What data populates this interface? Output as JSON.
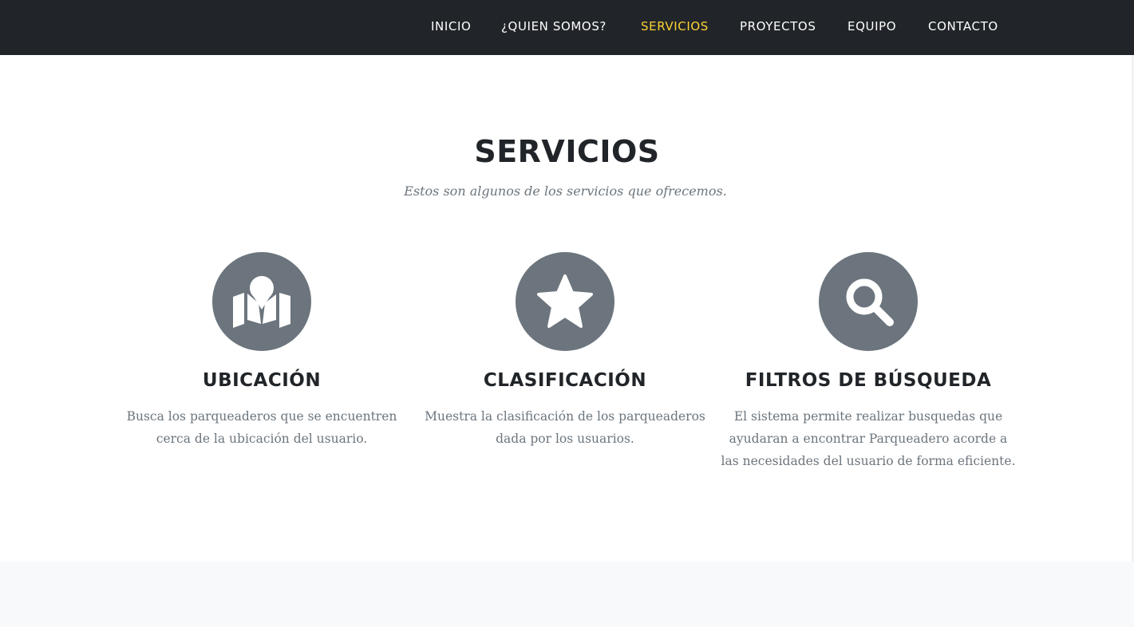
{
  "nav": {
    "items": [
      {
        "label": "INICIO"
      },
      {
        "label": "¿QUIEN SOMOS?"
      },
      {
        "label": "SERVICIOS",
        "active": true
      },
      {
        "label": "PROYECTOS"
      },
      {
        "label": "EQUIPO"
      },
      {
        "label": "CONTACTO"
      }
    ]
  },
  "section": {
    "title": "SERVICIOS",
    "subtitle": "Estos son algunos de los servicios que ofrecemos."
  },
  "services": [
    {
      "icon": "map-marker-icon",
      "title": "UBICACIÓN",
      "lines": [
        "Busca los parqueaderos que se encuentren",
        "cerca de la ubicación del usuario."
      ]
    },
    {
      "icon": "star-icon",
      "title": "CLASIFICACIÓN",
      "lines": [
        "Muestra la clasificación de los parqueaderos",
        "dada por los usuarios."
      ]
    },
    {
      "icon": "search-icon",
      "title": "FILTROS DE BÚSQUEDA",
      "lines": [
        "El sistema permite realizar busquedas que",
        "ayudaran a encontrar Parqueadero acorde a",
        "las necesidades del usuario de forma eficiente."
      ]
    }
  ],
  "colors": {
    "navbar_bg": "#212529",
    "nav_active": "#fed136",
    "icon_circle": "#6c757d",
    "heading": "#212529",
    "muted_text": "#6c757d"
  }
}
